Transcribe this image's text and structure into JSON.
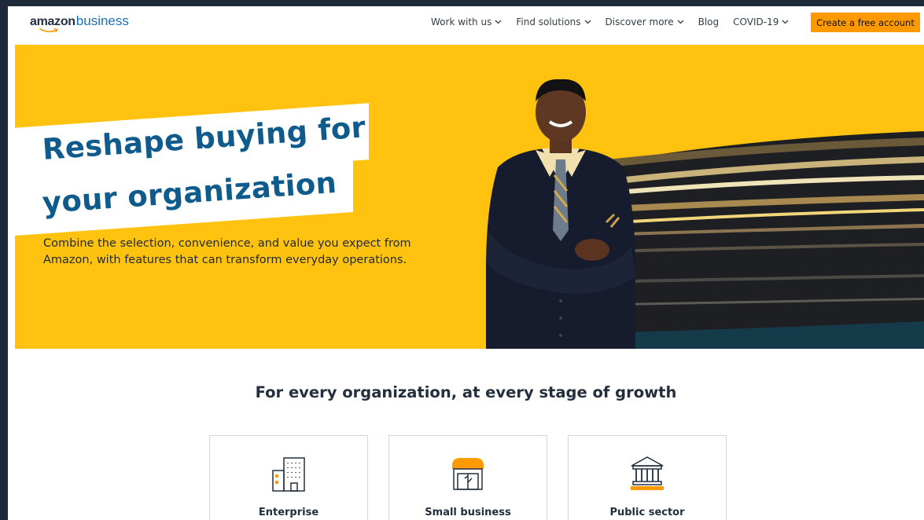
{
  "brand": {
    "logo_word1": "amazon",
    "logo_word2": "business",
    "accent_color": "#ff9900",
    "hero_color": "#fec20f",
    "headline_color": "#0f5c8c"
  },
  "nav": {
    "items": [
      {
        "label": "Work with us",
        "has_dropdown": true
      },
      {
        "label": "Find solutions",
        "has_dropdown": true
      },
      {
        "label": "Discover more",
        "has_dropdown": true
      },
      {
        "label": "Blog",
        "has_dropdown": false
      },
      {
        "label": "COVID-19",
        "has_dropdown": true
      }
    ],
    "cta_label": "Create a free account"
  },
  "hero": {
    "headline_line1": "Reshape buying for",
    "headline_line2": "your organization",
    "description": "Combine the selection, convenience, and value you expect from Amazon, with features that can transform everyday operations."
  },
  "section": {
    "title": "For every organization, at every stage of growth",
    "cards": [
      {
        "label": "Enterprise",
        "icon": "office-building-icon"
      },
      {
        "label": "Small business",
        "icon": "storefront-icon"
      },
      {
        "label": "Public sector",
        "icon": "government-building-icon"
      }
    ]
  }
}
